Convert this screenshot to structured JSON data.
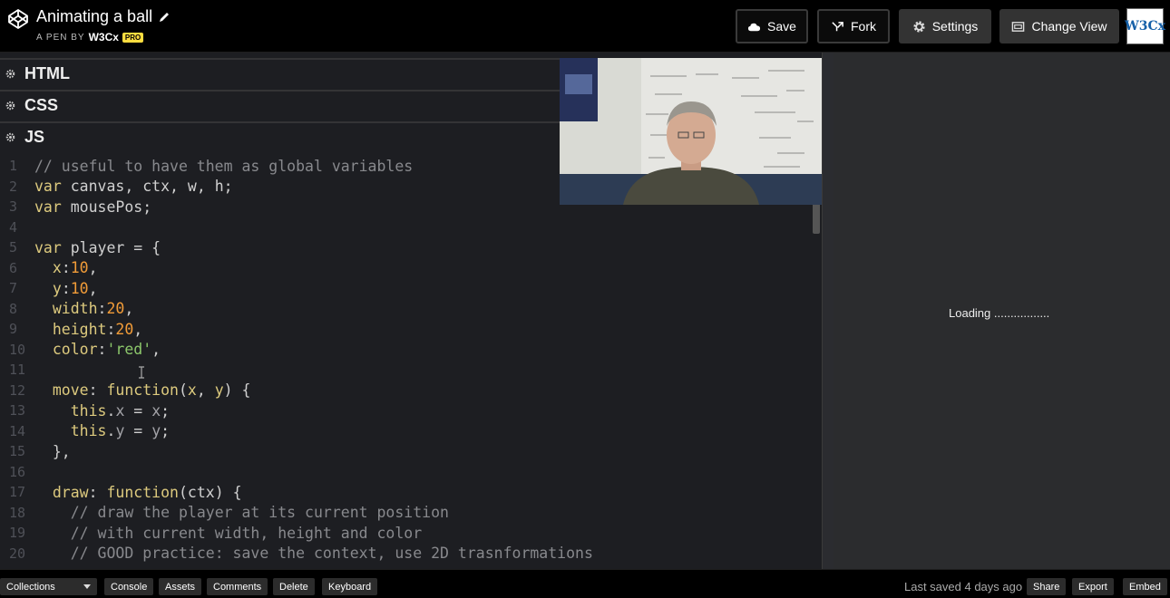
{
  "header": {
    "title": "Animating a ball",
    "byline_prefix": "A PEN BY",
    "author": "W3Cx",
    "badge": "PRO",
    "save_label": "Save",
    "fork_label": "Fork",
    "settings_label": "Settings",
    "change_view_label": "Change View",
    "avatar_text": "W3Cx"
  },
  "panels": {
    "html": "HTML",
    "css": "CSS",
    "js": "JS"
  },
  "result": {
    "loading_text": "Loading ................."
  },
  "footer": {
    "collections": "Collections",
    "console": "Console",
    "assets": "Assets",
    "comments": "Comments",
    "delete": "Delete",
    "keyboard": "Keyboard",
    "last_saved": "Last saved 4 days ago",
    "share": "Share",
    "export": "Export",
    "embed": "Embed"
  },
  "code_lines": [
    {
      "n": "1",
      "fold": false,
      "tokens": [
        [
          "c-comment",
          "// useful to have them as global variables"
        ]
      ]
    },
    {
      "n": "2",
      "fold": false,
      "tokens": [
        [
          "c-kw",
          "var"
        ],
        [
          "c-plain",
          " canvas, ctx, w, h;"
        ]
      ]
    },
    {
      "n": "3",
      "fold": false,
      "tokens": [
        [
          "c-kw",
          "var"
        ],
        [
          "c-plain",
          " mousePos;"
        ]
      ]
    },
    {
      "n": "4",
      "fold": false,
      "tokens": []
    },
    {
      "n": "5",
      "fold": true,
      "tokens": [
        [
          "c-kw",
          "var"
        ],
        [
          "c-plain",
          " player = {"
        ]
      ]
    },
    {
      "n": "6",
      "fold": false,
      "tokens": [
        [
          "c-plain",
          "  "
        ],
        [
          "c-kw",
          "x"
        ],
        [
          "c-plain",
          ":"
        ],
        [
          "c-num",
          "10"
        ],
        [
          "c-plain",
          ","
        ]
      ]
    },
    {
      "n": "7",
      "fold": false,
      "tokens": [
        [
          "c-plain",
          "  "
        ],
        [
          "c-kw",
          "y"
        ],
        [
          "c-plain",
          ":"
        ],
        [
          "c-num",
          "10"
        ],
        [
          "c-plain",
          ","
        ]
      ]
    },
    {
      "n": "8",
      "fold": false,
      "tokens": [
        [
          "c-plain",
          "  "
        ],
        [
          "c-kw",
          "width"
        ],
        [
          "c-plain",
          ":"
        ],
        [
          "c-num",
          "20"
        ],
        [
          "c-plain",
          ","
        ]
      ]
    },
    {
      "n": "9",
      "fold": false,
      "tokens": [
        [
          "c-plain",
          "  "
        ],
        [
          "c-kw",
          "height"
        ],
        [
          "c-plain",
          ":"
        ],
        [
          "c-num",
          "20"
        ],
        [
          "c-plain",
          ","
        ]
      ]
    },
    {
      "n": "10",
      "fold": false,
      "tokens": [
        [
          "c-plain",
          "  "
        ],
        [
          "c-kw",
          "color"
        ],
        [
          "c-plain",
          ":"
        ],
        [
          "c-str",
          "'red'"
        ],
        [
          "c-plain",
          ","
        ]
      ]
    },
    {
      "n": "11",
      "fold": false,
      "tokens": []
    },
    {
      "n": "12",
      "fold": true,
      "tokens": [
        [
          "c-plain",
          "  "
        ],
        [
          "c-kw",
          "move"
        ],
        [
          "c-plain",
          ": "
        ],
        [
          "c-kw",
          "function"
        ],
        [
          "c-plain",
          "("
        ],
        [
          "c-kw",
          "x"
        ],
        [
          "c-plain",
          ", "
        ],
        [
          "c-kw",
          "y"
        ],
        [
          "c-plain",
          ") {"
        ]
      ]
    },
    {
      "n": "13",
      "fold": false,
      "tokens": [
        [
          "c-plain",
          "    "
        ],
        [
          "c-kw",
          "this"
        ],
        [
          "c-plain",
          "."
        ],
        [
          "c-prop",
          "x"
        ],
        [
          "c-plain",
          " = "
        ],
        [
          "c-prop",
          "x"
        ],
        [
          "c-plain",
          ";"
        ]
      ]
    },
    {
      "n": "14",
      "fold": false,
      "tokens": [
        [
          "c-plain",
          "    "
        ],
        [
          "c-kw",
          "this"
        ],
        [
          "c-plain",
          "."
        ],
        [
          "c-prop",
          "y"
        ],
        [
          "c-plain",
          " = "
        ],
        [
          "c-prop",
          "y"
        ],
        [
          "c-plain",
          ";"
        ]
      ]
    },
    {
      "n": "15",
      "fold": false,
      "tokens": [
        [
          "c-plain",
          "  },"
        ]
      ]
    },
    {
      "n": "16",
      "fold": false,
      "tokens": []
    },
    {
      "n": "17",
      "fold": true,
      "tokens": [
        [
          "c-plain",
          "  "
        ],
        [
          "c-kw",
          "draw"
        ],
        [
          "c-plain",
          ": "
        ],
        [
          "c-kw",
          "function"
        ],
        [
          "c-plain",
          "(ctx) {"
        ]
      ]
    },
    {
      "n": "18",
      "fold": false,
      "tokens": [
        [
          "c-plain",
          "    "
        ],
        [
          "c-comment",
          "// draw the player at its current position"
        ]
      ]
    },
    {
      "n": "19",
      "fold": false,
      "tokens": [
        [
          "c-plain",
          "    "
        ],
        [
          "c-comment",
          "// with current width, height and color"
        ]
      ]
    },
    {
      "n": "20",
      "fold": false,
      "tokens": [
        [
          "c-plain",
          "    "
        ],
        [
          "c-comment",
          "// GOOD practice: save the context, use 2D trasnformations"
        ]
      ]
    }
  ]
}
